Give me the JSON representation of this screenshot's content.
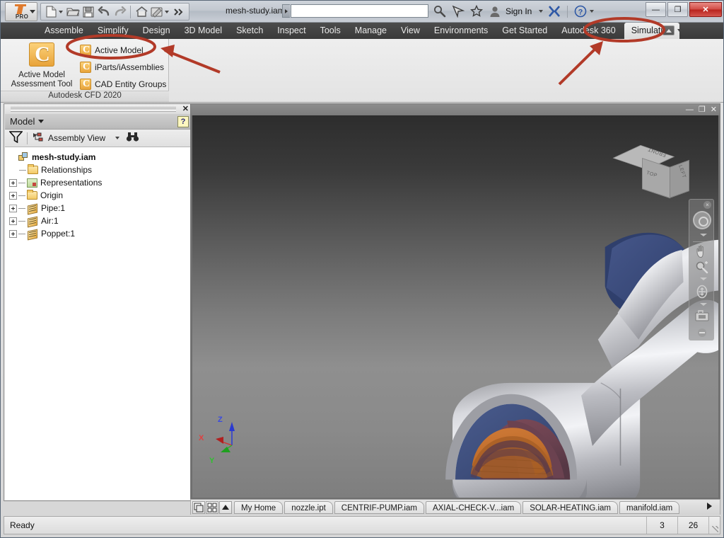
{
  "window": {
    "document_title": "mesh-study.iam",
    "minimize": "—",
    "maximize": "❐",
    "close": "✕"
  },
  "quick_access": {
    "app_button": {
      "label": "PRO",
      "name": "inventor-app-button"
    },
    "items": [
      {
        "icon": "new-file-icon",
        "label": "New"
      },
      {
        "icon": "chevron-down-icon",
        "label": "New options"
      },
      {
        "icon": "open-folder-icon",
        "label": "Open"
      },
      {
        "icon": "save-icon",
        "label": "Save"
      },
      {
        "icon": "undo-icon",
        "label": "Undo"
      },
      {
        "icon": "redo-icon",
        "label": "Redo"
      },
      {
        "icon": "home-icon",
        "label": "Home"
      },
      {
        "icon": "appearance-icon",
        "label": "Appearance"
      },
      {
        "icon": "chevron-down-icon",
        "label": "Appearance options"
      },
      {
        "icon": "overflow-icon",
        "label": "More commands"
      }
    ]
  },
  "search": {
    "value": "",
    "placeholder": ""
  },
  "account": {
    "search_icon": "search-icon",
    "share_icon": "share-icon",
    "favorites_icon": "star-icon",
    "user_icon": "person-icon",
    "sign_in_label": "Sign In",
    "exchange_icon": "autodesk-exchange-icon",
    "help_icon": "help-icon"
  },
  "ribbon": {
    "tabs": [
      {
        "label": "Assemble",
        "active": false
      },
      {
        "label": "Simplify",
        "active": false
      },
      {
        "label": "Design",
        "active": false
      },
      {
        "label": "3D Model",
        "active": false
      },
      {
        "label": "Sketch",
        "active": false
      },
      {
        "label": "Inspect",
        "active": false
      },
      {
        "label": "Tools",
        "active": false
      },
      {
        "label": "Manage",
        "active": false
      },
      {
        "label": "View",
        "active": false
      },
      {
        "label": "Environments",
        "active": false
      },
      {
        "label": "Get Started",
        "active": false
      },
      {
        "label": "Autodesk 360",
        "active": false
      },
      {
        "label": "Simulation",
        "active": true
      }
    ],
    "panel": {
      "title": "Autodesk CFD  2020",
      "big_button": {
        "line1": "Active Model",
        "line2": "Assessment Tool",
        "icon": "cfd-icon"
      },
      "items": [
        {
          "label": "Active Model",
          "icon": "cfd-icon"
        },
        {
          "label": "iParts/iAssemblies",
          "icon": "cfd-icon"
        },
        {
          "label": "CAD Entity Groups",
          "icon": "cfd-icon"
        }
      ]
    }
  },
  "browser": {
    "panel_title": "Model",
    "close_label": "✕",
    "help_label": "?",
    "filter_icon": "filter-icon",
    "view_selector": "Assembly View",
    "find_icon": "binoculars-icon",
    "tree": [
      {
        "label": "mesh-study.iam",
        "depth": 0,
        "icon": "assembly-icon",
        "expander": "none",
        "bold": true
      },
      {
        "label": "Relationships",
        "depth": 1,
        "icon": "folder-icon",
        "expander": "none"
      },
      {
        "label": "Representations",
        "depth": 1,
        "icon": "representations-icon",
        "expander": "plus"
      },
      {
        "label": "Origin",
        "depth": 1,
        "icon": "folder-icon",
        "expander": "plus"
      },
      {
        "label": "Pipe:1",
        "depth": 1,
        "icon": "part-icon",
        "expander": "plus"
      },
      {
        "label": "Air:1",
        "depth": 1,
        "icon": "part-icon",
        "expander": "plus"
      },
      {
        "label": "Poppet:1",
        "depth": 1,
        "icon": "part-icon",
        "expander": "plus"
      }
    ]
  },
  "viewport": {
    "doc_minimize": "—",
    "doc_restore": "❐",
    "doc_close": "✕",
    "viewcube": {
      "front": "FRONT",
      "top": "TOP",
      "left": "LEFT"
    },
    "axis_triad": {
      "x": "X",
      "y": "Y",
      "z": "Z",
      "x_color": "#d03030",
      "y_color": "#2db02d",
      "z_color": "#3040d0"
    },
    "navbar": {
      "close": "×",
      "items": [
        {
          "icon": "steering-wheel-icon"
        },
        {
          "icon": "chevron-down-icon"
        },
        {
          "icon": "pan-hand-icon"
        },
        {
          "icon": "zoom-magnifier-icon"
        },
        {
          "icon": "chevron-down-icon"
        },
        {
          "icon": "orbit-icon"
        },
        {
          "icon": "chevron-down-icon"
        },
        {
          "icon": "look-camera-icon"
        }
      ]
    },
    "model_colors": {
      "pipe_body": "#b8b9bd",
      "air_section": "#3f4f7d",
      "poppet_orange": "#c4702f",
      "inner_maroon": "#6e4250"
    }
  },
  "document_tabs": {
    "tile_icon": "tile-windows-icon",
    "grid_icon": "grid-windows-icon",
    "up_icon": "chevron-up-icon",
    "tabs": [
      {
        "label": "My Home"
      },
      {
        "label": "nozzle.ipt"
      },
      {
        "label": "CENTRIF-PUMP.iam"
      },
      {
        "label": "AXIAL-CHECK-V...iam"
      },
      {
        "label": "SOLAR-HEATING.iam"
      },
      {
        "label": "manifold.iam"
      }
    ],
    "more_icon": "chevron-right-icon"
  },
  "status_bar": {
    "message": "Ready",
    "cells": [
      "3",
      "26"
    ]
  },
  "annotations": {
    "highlight_color": "#b23a28",
    "targets": [
      "Active Model",
      "Simulation"
    ]
  }
}
